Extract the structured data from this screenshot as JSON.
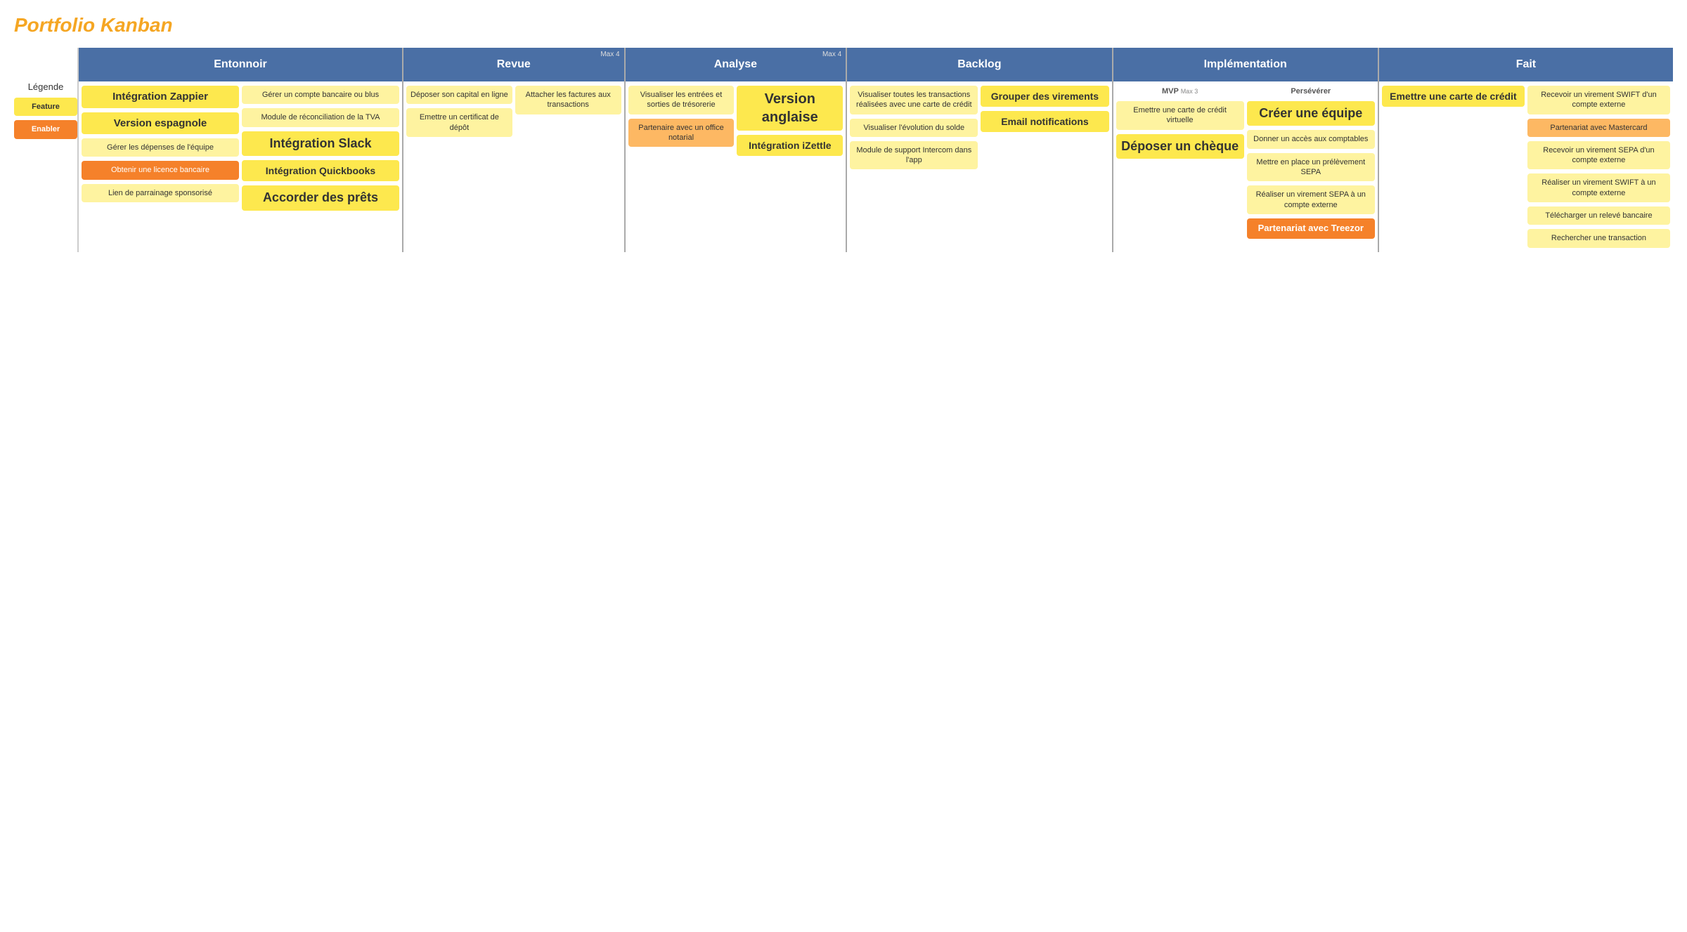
{
  "title": "Portfolio Kanban",
  "legend": {
    "label": "Légende",
    "feature": "Feature",
    "enabler": "Enabler"
  },
  "columns": {
    "entonnoir": {
      "header": "Entonnoir",
      "subcol1": [
        {
          "text": "Intégration Zappier",
          "type": "yellow",
          "size": "medium"
        },
        {
          "text": "Version espagnole",
          "type": "yellow",
          "size": "medium"
        },
        {
          "text": "Gérer les dépenses de l'équipe",
          "type": "yellow-light",
          "size": "small"
        },
        {
          "text": "Obtenir une licence bancaire",
          "type": "orange",
          "size": "small"
        },
        {
          "text": "Lien de parrainage sponsorisé",
          "type": "yellow-light",
          "size": "small"
        }
      ],
      "subcol2": [
        {
          "text": "Gérer un compte bancaire ou blus",
          "type": "yellow-light",
          "size": "small"
        },
        {
          "text": "Module de réconciliation de la TVA",
          "type": "yellow-light",
          "size": "small"
        },
        {
          "text": "Intégration Slack",
          "type": "yellow",
          "size": "large"
        },
        {
          "text": "Intégration Quickbooks",
          "type": "yellow",
          "size": "medium"
        },
        {
          "text": "Accorder des prêts",
          "type": "yellow",
          "size": "large"
        }
      ]
    },
    "revue": {
      "header": "Revue",
      "max": "Max 4",
      "subcol1": [
        {
          "text": "Déposer son capital en ligne",
          "type": "yellow-light",
          "size": "small"
        },
        {
          "text": "Emettre un certificat de dépôt",
          "type": "yellow-light",
          "size": "small"
        }
      ],
      "subcol2": [
        {
          "text": "Attacher les factures aux transactions",
          "type": "yellow-light",
          "size": "small"
        }
      ]
    },
    "analyse": {
      "header": "Analyse",
      "max": "Max 4",
      "subcol1": [
        {
          "text": "Visualiser les entrées et sorties de trésorerie",
          "type": "yellow-light",
          "size": "small"
        },
        {
          "text": "Partenaire avec un office notarial",
          "type": "orange-light",
          "size": "small"
        }
      ],
      "subcol2": [
        {
          "text": "Version anglaise",
          "type": "yellow",
          "size": "large"
        },
        {
          "text": "Intégration iZettle",
          "type": "yellow",
          "size": "medium"
        }
      ]
    },
    "backlog": {
      "header": "Backlog",
      "subcol1": [
        {
          "text": "Visualiser toutes les transactions réalisées avec une carte de crédit",
          "type": "yellow-light",
          "size": "small"
        },
        {
          "text": "Visualiser l'évolution du solde",
          "type": "yellow-light",
          "size": "small"
        },
        {
          "text": "Module de support Intercom dans l'app",
          "type": "yellow-light",
          "size": "small"
        }
      ],
      "subcol2": [
        {
          "text": "Grouper des virements",
          "type": "yellow",
          "size": "medium"
        },
        {
          "text": "Email notifications",
          "type": "yellow",
          "size": "medium"
        }
      ]
    },
    "implementation": {
      "header": "Implémentation",
      "subcol1": {
        "label": "MVP",
        "max": "Max 3",
        "cards": [
          {
            "text": "Emettre une carte de crédit virtuelle",
            "type": "yellow-light",
            "size": "small"
          },
          {
            "text": "Déposer un chèque",
            "type": "yellow",
            "size": "large"
          }
        ]
      },
      "subcol2": {
        "label": "Persévérer",
        "cards": [
          {
            "text": "Créer une équipe",
            "type": "yellow",
            "size": "large"
          },
          {
            "text": "Donner un accès aux comptables",
            "type": "yellow-light",
            "size": "small"
          },
          {
            "text": "Mettre en place un prélèvement SEPA",
            "type": "yellow-light",
            "size": "small"
          },
          {
            "text": "Réaliser un virement SEPA à un compte externe",
            "type": "yellow-light",
            "size": "small"
          },
          {
            "text": "Partenariat avec Treezor",
            "type": "orange",
            "size": "medium"
          }
        ]
      }
    },
    "fait": {
      "header": "Fait",
      "subcol1": [
        {
          "text": "Emettre une carte de crédit",
          "type": "yellow",
          "size": "medium"
        }
      ],
      "subcol2": [
        {
          "text": "Recevoir un virement SWIFT d'un compte externe",
          "type": "yellow-light",
          "size": "small"
        },
        {
          "text": "Partenariat avec Mastercard",
          "type": "orange-light",
          "size": "small"
        },
        {
          "text": "Recevoir un virement SEPA d'un compte externe",
          "type": "yellow-light",
          "size": "small"
        },
        {
          "text": "Réaliser un virement SWIFT à un compte externe",
          "type": "yellow-light",
          "size": "small"
        },
        {
          "text": "Télécharger un relevé bancaire",
          "type": "yellow-light",
          "size": "small"
        },
        {
          "text": "Rechercher une transaction",
          "type": "yellow-light",
          "size": "small"
        }
      ]
    }
  }
}
